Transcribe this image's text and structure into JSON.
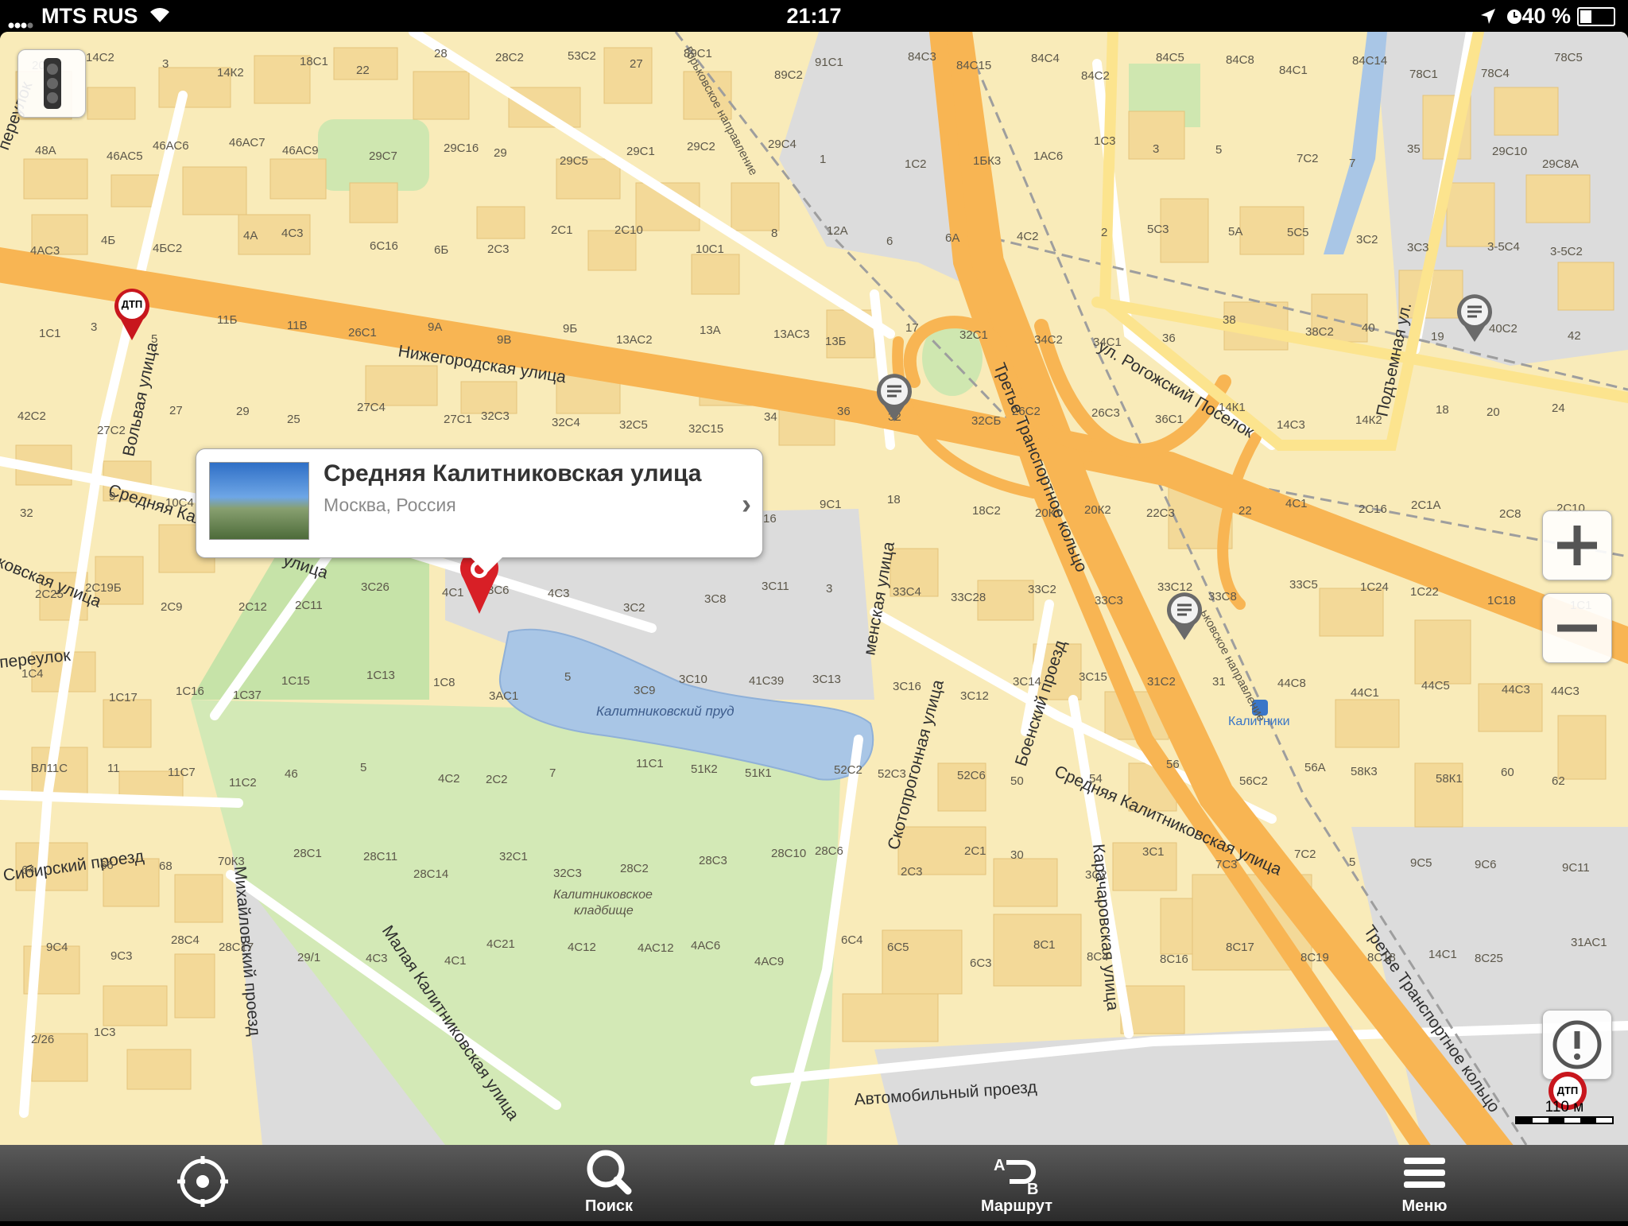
{
  "status_bar": {
    "carrier": "MTS RUS",
    "time": "21:17",
    "battery": "40 %",
    "battery_level": 0.4
  },
  "callout": {
    "title": "Средняя Калитниковская улица",
    "subtitle": "Москва, Россия"
  },
  "streets": {
    "nizhegorodskaya": "Нижегородская улица",
    "ttk_north": "Третье Транспортное кольцо",
    "ttk_south": "Третье Транспортное кольцо",
    "rogozhsky": "ул. Рогожский Поселок",
    "podyemnaya": "Подъемная ул.",
    "srednyaya_kalit_east": "Средняя Калитниковская улица",
    "srednyaya_kalit_west": "Средняя Кал",
    "ulitsa_fragment": "улица",
    "malaya_kalit": "Малая Калитниковская улица",
    "mikhaylovsky": "Михайловский проезд",
    "sibirsky": "Сибирский проезд",
    "avtomobilny": "Автомобильный проезд",
    "skotoprogonnaya": "Скотопрогонная улица",
    "karacharovskaya": "Карачаровская улица",
    "boensky": "Боенский проезд",
    "vostochnaya": "Вольвая улица",
    "menskaya": "менская улица",
    "pereulok_top": "переулок",
    "pereulok_mid": "переулок",
    "kovskaya": "ковская улица",
    "gorkovskoe": "Горьковское направление",
    "gorkovskoe2": "ьковское направление"
  },
  "places": {
    "pond": "Калитниковский пруд",
    "cemetery_line1": "Калитниковское",
    "cemetery_line2": "кладбище",
    "station": "Калитники"
  },
  "building_numbers": [
    "20",
    "14С2",
    "3",
    "14К2",
    "18С1",
    "22",
    "28",
    "28С2",
    "53С2",
    "27",
    "89С1",
    "89С2",
    "91С1",
    "84С3",
    "84С15",
    "84С4",
    "84С2",
    "84С5",
    "84С8",
    "84С1",
    "84С14",
    "78С1",
    "78С4",
    "78С5",
    "48А",
    "46АС5",
    "46АС6",
    "46АС7",
    "46АС9",
    "29С7",
    "29С16",
    "29",
    "29С5",
    "29С1",
    "29С2",
    "29С4",
    "1",
    "1С2",
    "1БК3",
    "1АС6",
    "1С3",
    "3",
    "5",
    "7С2",
    "7",
    "35",
    "29С10",
    "29С8А",
    "4АС3",
    "4Б",
    "4БС2",
    "4А",
    "4С3",
    "6С16",
    "6Б",
    "2С3",
    "2С1",
    "2С10",
    "10С1",
    "8",
    "12А",
    "6",
    "6А",
    "4С2",
    "2",
    "5С3",
    "5А",
    "5С5",
    "3С2",
    "3С3",
    "3-5С4",
    "3-5С2",
    "1С1",
    "3",
    "5",
    "11Б",
    "11В",
    "26С1",
    "9А",
    "9В",
    "9Б",
    "13АС2",
    "13А",
    "13АС3",
    "13Б",
    "17",
    "32С1",
    "34С2",
    "34С1",
    "36",
    "38",
    "38С2",
    "40",
    "19",
    "40С2",
    "42",
    "42С2",
    "27С2",
    "27",
    "29",
    "25",
    "27С4",
    "27С1",
    "32С3",
    "32С4",
    "32С5",
    "32С15",
    "34",
    "36",
    "32",
    "32СБ",
    "26С2",
    "26С3",
    "36С1",
    "14К1",
    "14С3",
    "14К2",
    "18",
    "20",
    "24",
    "32",
    "9",
    "10С4",
    "10",
    "10С2",
    "3",
    "22С1",
    "24",
    "47АК2",
    "47АК1",
    "45",
    "16",
    "9С1",
    "18",
    "18С2",
    "20К1",
    "20К2",
    "22С3",
    "22",
    "4С1",
    "2С16",
    "2С1А",
    "2С8",
    "2С10",
    "2С25",
    "2С19Б",
    "2С9",
    "2С12",
    "2С11",
    "3С26",
    "4С1",
    "3С6",
    "4С3",
    "3С2",
    "3С8",
    "3С11",
    "3",
    "33С4",
    "33С28",
    "33С2",
    "33С3",
    "33С12",
    "33С8",
    "33С5",
    "1С24",
    "1С22",
    "1С18",
    "1С1",
    "1С4",
    "1С17",
    "1С16",
    "1С37",
    "1С15",
    "1С13",
    "1С8",
    "3АС1",
    "5",
    "3С9",
    "3С10",
    "41С39",
    "3С13",
    "3С16",
    "3С12",
    "3С14",
    "3С15",
    "31С2",
    "31",
    "44С8",
    "44С1",
    "44С5",
    "44С3",
    "44С3",
    "ВЛ11С",
    "11",
    "11С7",
    "11С2",
    "46",
    "5",
    "4С2",
    "2С2",
    "7",
    "11С1",
    "51К2",
    "51К1",
    "52С2",
    "52С3",
    "52С6",
    "50",
    "54",
    "56",
    "56С2",
    "56А",
    "58К3",
    "58К1",
    "60",
    "62",
    "64",
    "66",
    "68",
    "70К3",
    "28С1",
    "28С11",
    "28С14",
    "32С1",
    "32С3",
    "28С2",
    "28С3",
    "28С10",
    "28С6",
    "2С3",
    "2С1",
    "30",
    "3С2",
    "3С1",
    "7С3",
    "7С2",
    "5",
    "9С5",
    "9С6",
    "9С11",
    "9С4",
    "9С3",
    "28С4",
    "28С17",
    "29/1",
    "4С3",
    "4С1",
    "4С21",
    "4С12",
    "4АС12",
    "4АС6",
    "4АС9",
    "6С4",
    "6С5",
    "6С3",
    "8С1",
    "8С4",
    "8С16",
    "8С17",
    "8С19",
    "8С18",
    "14С1",
    "8С25",
    "31АС1",
    "2/26",
    "1С3"
  ],
  "markers": {
    "dtp_label": "ДТП",
    "scale": "110 м"
  },
  "toolbar": {
    "search": "Поиск",
    "route": "Маршрут",
    "route_a": "A",
    "route_b": "B",
    "menu": "Меню"
  },
  "colors": {
    "land": "#f9ebb9",
    "building": "#f3d998",
    "major_road": "#f8b553",
    "park": "#cfe7b0",
    "water": "#a9c6e6",
    "industrial": "#d6d6d6",
    "pin": "#d81f26"
  }
}
